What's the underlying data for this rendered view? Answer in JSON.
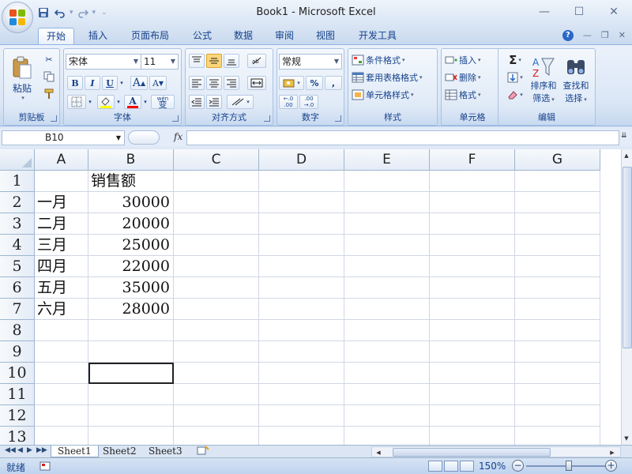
{
  "window": {
    "title": "Book1 - Microsoft Excel",
    "minimize_glyph": "—",
    "maximize_glyph": "☐",
    "close_glyph": "✕"
  },
  "ribbon_tabs": [
    "开始",
    "插入",
    "页面布局",
    "公式",
    "数据",
    "审阅",
    "视图",
    "开发工具"
  ],
  "active_tab": "开始",
  "clipboard": {
    "paste_label": "粘贴",
    "group_label": "剪贴板"
  },
  "font": {
    "name": "宋体",
    "size": "11",
    "bold": "B",
    "italic": "I",
    "underline": "U",
    "grow": "A",
    "shrink": "A",
    "font_color_letter": "A",
    "wen_label": "wén",
    "wen_char": "变",
    "group_label": "字体"
  },
  "alignment": {
    "group_label": "对齐方式"
  },
  "number": {
    "format": "常规",
    "percent": "%",
    "comma": ",",
    "inc_decimal": "←.0 .00",
    "dec_decimal": ".00 →.0",
    "group_label": "数字"
  },
  "styles": {
    "conditional": "条件格式",
    "table_format": "套用表格格式",
    "cell_styles": "单元格样式",
    "group_label": "样式"
  },
  "cells_group": {
    "insert": "插入",
    "delete": "删除",
    "format": "格式",
    "group_label": "单元格"
  },
  "editing": {
    "sigma": "Σ",
    "sort_line1": "排序和",
    "sort_line2": "筛选",
    "find_line1": "查找和",
    "find_line2": "选择",
    "group_label": "编辑"
  },
  "formula_bar": {
    "name_box": "B10",
    "fx": "fx",
    "content": ""
  },
  "sheet": {
    "columns": [
      "A",
      "B",
      "C",
      "D",
      "E",
      "F",
      "G"
    ],
    "rows": [
      "1",
      "2",
      "3",
      "4",
      "5",
      "6",
      "7",
      "8",
      "9",
      "10",
      "11",
      "12",
      "13"
    ],
    "data": [
      {
        "a": "",
        "b": "销售额"
      },
      {
        "a": "一月",
        "b": "30000"
      },
      {
        "a": "二月",
        "b": "20000"
      },
      {
        "a": "三月",
        "b": "25000"
      },
      {
        "a": "四月",
        "b": "22000"
      },
      {
        "a": "五月",
        "b": "35000"
      },
      {
        "a": "六月",
        "b": "28000"
      }
    ],
    "active_cell": "B10"
  },
  "sheet_tabs": [
    "Sheet1",
    "Sheet2",
    "Sheet3"
  ],
  "active_sheet": "Sheet1",
  "status": {
    "ready": "就绪",
    "zoom": "150%",
    "zoom_out": "−",
    "zoom_in": "+"
  },
  "colors": {
    "ribbon_text": "#15428b",
    "grid_line": "#d0d7e5",
    "header_border": "#9eb6ce"
  }
}
